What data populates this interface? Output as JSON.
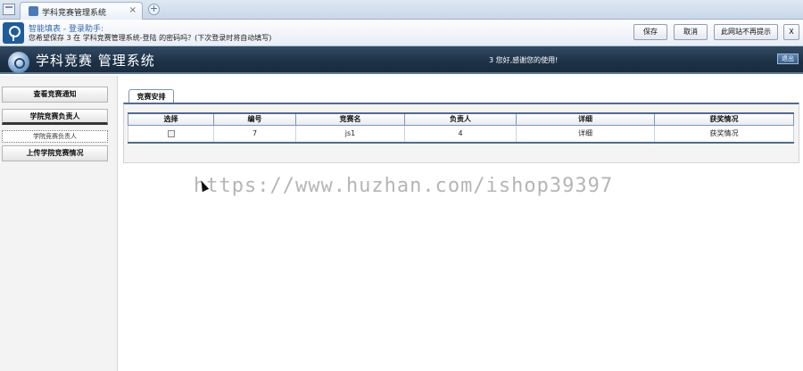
{
  "browser": {
    "tab_title": "学科竞赛管理系统",
    "tab_close": "×",
    "new_tab": "+"
  },
  "helper": {
    "title": "智能填表 - 登录助手:",
    "message": "您希望保存 3 在 学科竞赛管理系统-登陆 的密码吗？(下次登录时将自动填写)",
    "save_label": "保存",
    "cancel_label": "取消",
    "never_label": "此网站不再提示",
    "close_label": "X"
  },
  "header": {
    "title": "学科竞赛 管理系统",
    "welcome": "3 您好,感谢您的使用!",
    "logout_label": "退出"
  },
  "sidebar": {
    "items": [
      {
        "label": "查看竞赛通知"
      },
      {
        "label": "学院竞赛负责人"
      },
      {
        "label": "上传学院竞赛情况"
      }
    ],
    "sub_item": "学院竞赛负责人"
  },
  "main": {
    "tab_label": "竞赛安排",
    "table": {
      "headers": [
        "选择",
        "编号",
        "竞赛名",
        "负责人",
        "详细",
        "获奖情况"
      ],
      "rows": [
        {
          "id": "7",
          "name": "js1",
          "leader": "4",
          "detail": "详细",
          "award": "获奖情况"
        }
      ]
    }
  },
  "watermark": "https://www.huzhan.com/ishop39397"
}
